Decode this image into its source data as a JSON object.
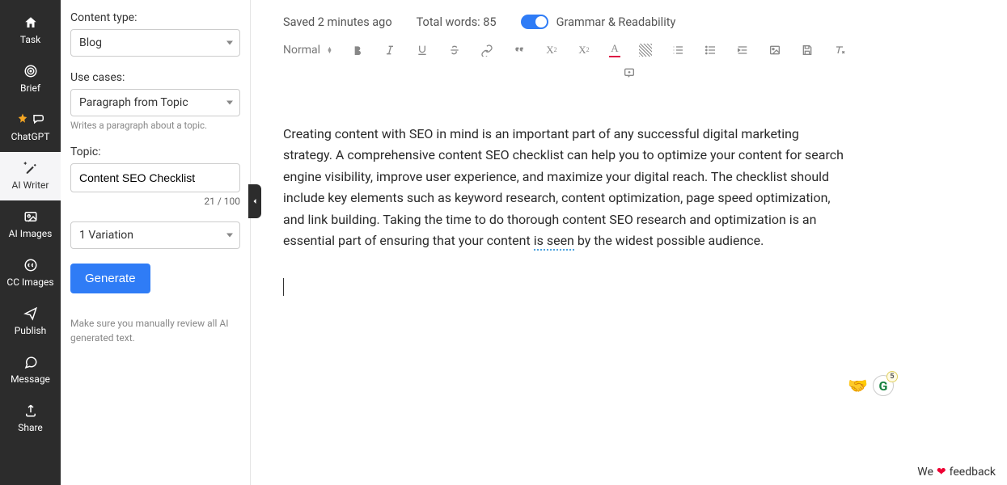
{
  "nav": {
    "task": "Task",
    "brief": "Brief",
    "chatgpt": "ChatGPT",
    "ai_writer": "AI Writer",
    "ai_images": "AI Images",
    "cc_images": "CC Images",
    "publish": "Publish",
    "message": "Message",
    "share": "Share"
  },
  "form": {
    "content_type_label": "Content type:",
    "content_type_value": "Blog",
    "use_cases_label": "Use cases:",
    "use_cases_value": "Paragraph from Topic",
    "use_cases_helper": "Writes a paragraph about a topic.",
    "topic_label": "Topic:",
    "topic_value": "Content SEO Checklist",
    "char_count": "21 / 100",
    "variation_value": "1 Variation",
    "generate_label": "Generate",
    "review_note": "Make sure you manually review all AI generated text."
  },
  "header": {
    "saved": "Saved 2 minutes ago",
    "word_count": "Total words: 85",
    "grammar_label": "Grammar & Readability"
  },
  "toolbar": {
    "style_label": "Normal"
  },
  "document": {
    "para_before": "Creating content with SEO in mind is an important part of any successful digital marketing strategy. A comprehensive content SEO checklist can help you to optimize your content for search engine visibility, improve user experience, and maximize your digital reach. The checklist should include key elements such as keyword research, content optimization, page speed optimization, and link building. Taking the time to do thorough content SEO research and optimization is an essential part of ensuring that your content ",
    "squiggle": "is seen",
    "para_after": " by the widest possible audience."
  },
  "feedback": {
    "prefix": "We ",
    "suffix": " feedback"
  },
  "badges": {
    "handshake": "🤝",
    "g_letter": "G",
    "g_count": "5"
  }
}
